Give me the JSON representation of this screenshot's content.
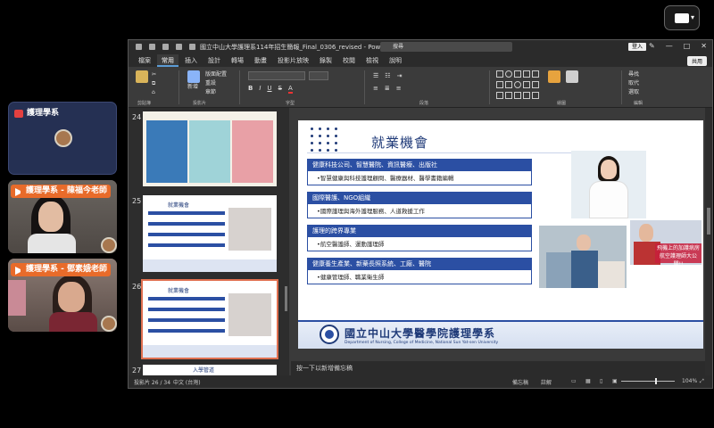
{
  "meeting": {
    "participants": [
      {
        "name": "護理學系",
        "muted": true
      },
      {
        "name": "護理學系 - 陳福今老師"
      },
      {
        "name": "護理學系 - 鄧素娥老師"
      }
    ]
  },
  "ppt": {
    "title": "國立中山大學護理系114年招生簡報_Final_0306_revised - PowerPoint",
    "search_placeholder": "搜尋",
    "login": "登入",
    "tabs": [
      "檔案",
      "常用",
      "插入",
      "設計",
      "轉場",
      "動畫",
      "投影片放映",
      "錄製",
      "校閱",
      "檢視",
      "說明"
    ],
    "active_tab": "常用",
    "share": "共用",
    "ribbon_groups": [
      "剪貼簿",
      "投影片",
      "字型",
      "段落",
      "繪圖",
      "編輯"
    ],
    "ribbon_items": {
      "layout": "版面配置",
      "reset": "重設",
      "section": "章節",
      "new_slide": "新增",
      "find": "尋找",
      "replace": "取代",
      "select": "選取"
    },
    "thumbnails": [
      {
        "num": "24"
      },
      {
        "num": "25",
        "heading": "就業機會"
      },
      {
        "num": "26",
        "heading": "就業機會",
        "selected": true
      },
      {
        "num": "27",
        "heading": "入學管道"
      }
    ],
    "slide": {
      "title": "就業機會",
      "sections": [
        {
          "bar": "健康科技公司、智慧醫院、資訊醫療、出版社",
          "sub": "•智慧健康與科技護理顧問、醫療器材、醫學書籍編輯"
        },
        {
          "bar": "國際醫護、NGO組織",
          "sub": "•國際護理與海外護理服務、人道救援工作"
        },
        {
          "bar": "護理的跨界專業",
          "sub": "•航空醫護師、運動護理師"
        },
        {
          "bar": "健康養生產業、新藥長照系統、工廠、醫院",
          "sub": "•健康管理師、職業衛生師"
        }
      ],
      "photo_caption": "飛機上的加護病房\n航空護理師大公開!!",
      "school_name": "國立中山大學醫學院護理學系",
      "school_sub": "Department of Nursing, College of Medicine, National Sun Yat-sen University"
    },
    "notes_placeholder": "按一下以新增備忘稿",
    "status": {
      "slide": "投影片 26 / 34",
      "lang": "中文 (台灣)",
      "notes": "備忘稿",
      "comments": "註解",
      "zoom": "104%"
    }
  }
}
